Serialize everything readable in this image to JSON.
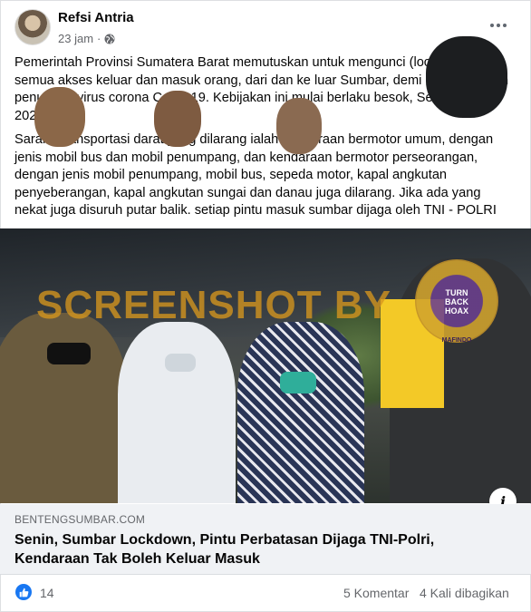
{
  "post": {
    "author": "Refsi Antria",
    "time": "23 jam",
    "separator": "·",
    "privacy_icon": "globe-icon",
    "paragraphs": [
      "Pemerintah Provinsi Sumatera Barat memutuskan untuk mengunci (lockdown)\nsemua akses keluar dan masuk orang, dari dan ke luar Sumbar, demi menghentikan\npenularan virus corona Covid-19. Kebijakan ini mulai berlaku besok, Senin, 27 April\n2020.",
      "Sarana transportasi darat yang dilarang ialah kendaraan bermotor umum, dengan\njenis mobil bus dan mobil penumpang, dan kendaraan bermotor perseorangan,\ndengan jenis mobil penumpang, mobil bus, sepeda motor, kapal angkutan\npenyeberangan, kapal angkutan sungai dan danau juga dilarang. Jika ada yang\nnekat juga disuruh putar balik. setiap pintu masuk sumbar dijaga oleh TNI - POLRI"
    ]
  },
  "image": {
    "watermark": "SCREENSHOT BY",
    "seal_center": "TURN BACK HOAX",
    "seal_ring": "MAFINDO",
    "info_icon": "info-icon"
  },
  "link_preview": {
    "domain": "BENTENGSUMBAR.COM",
    "title": "Senin, Sumbar Lockdown, Pintu Perbatasan Dijaga TNI-Polri, Kendaraan Tak Boleh Keluar Masuk"
  },
  "footer": {
    "reaction_icon": "like-icon",
    "reaction_count": "14",
    "comments": "5 Komentar",
    "shares": "4 Kali dibagikan"
  },
  "colors": {
    "accent": "#1877f2",
    "secondary_text": "#65676b",
    "preview_bg": "#f0f2f5",
    "watermark": "#d6961e"
  }
}
